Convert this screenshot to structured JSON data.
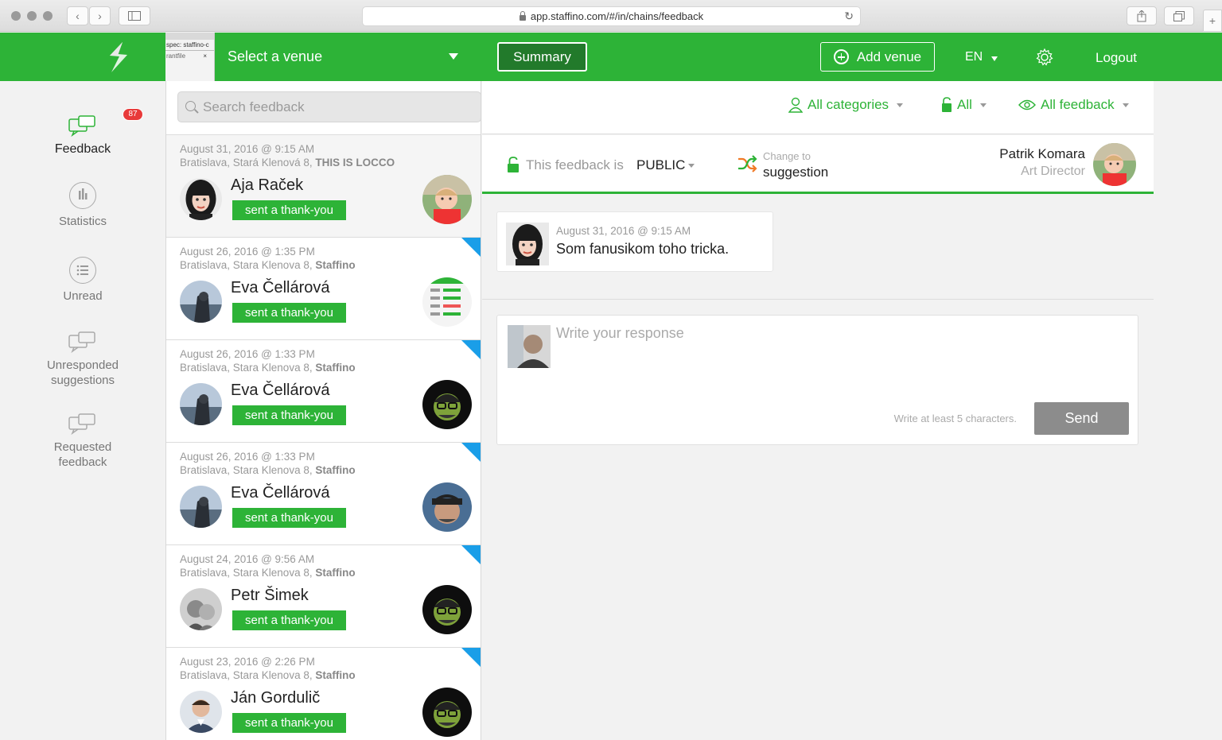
{
  "browser": {
    "url": "app.staffino.com/#/in/chains/feedback"
  },
  "header": {
    "venue_tab_line1": "spec: staffino-c",
    "venue_tab_line2": "rantfile",
    "venue_tab_close": "×",
    "venue_select": "Select a venue",
    "summary": "Summary",
    "add_venue": "Add venue",
    "language": "EN",
    "logout": "Logout",
    "brand_color": "#2db337"
  },
  "sidebar": {
    "badge": "87",
    "items": [
      {
        "label": "Feedback",
        "icon": "chat-bubbles-icon"
      },
      {
        "label": "Statistics",
        "icon": "bar-chart-icon"
      },
      {
        "label": "Unread",
        "icon": "list-icon"
      },
      {
        "label": "Unresponded suggestions",
        "icon": "chat-bubbles-icon"
      },
      {
        "label": "Requested feedback",
        "icon": "chat-bubbles-icon"
      }
    ]
  },
  "search": {
    "placeholder": "Search feedback"
  },
  "filters": {
    "categories": "All categories",
    "visibility": "All",
    "feedback": "All feedback"
  },
  "feedback_list": [
    {
      "date": "August 31, 2016 @ 9:15 AM",
      "location": "Bratislava, Stará Klenová 8, ",
      "venue": "THIS IS LOCCO",
      "name": "Aja Raček",
      "action": "sent a thank-you",
      "unread": false
    },
    {
      "date": "August 26, 2016 @ 1:35 PM",
      "location": "Bratislava, Stara Klenova 8, ",
      "venue": "Staffino",
      "name": "Eva Čellárová",
      "action": "sent a thank-you",
      "unread": true
    },
    {
      "date": "August 26, 2016 @ 1:33 PM",
      "location": "Bratislava, Stara Klenova 8, ",
      "venue": "Staffino",
      "name": "Eva Čellárová",
      "action": "sent a thank-you",
      "unread": true
    },
    {
      "date": "August 26, 2016 @ 1:33 PM",
      "location": "Bratislava, Stara Klenova 8, ",
      "venue": "Staffino",
      "name": "Eva Čellárová",
      "action": "sent a thank-you",
      "unread": true
    },
    {
      "date": "August 24, 2016 @ 9:56 AM",
      "location": "Bratislava, Stara Klenova 8, ",
      "venue": "Staffino",
      "name": "Petr Šimek",
      "action": "sent a thank-you",
      "unread": true
    },
    {
      "date": "August 23, 2016 @ 2:26 PM",
      "location": "Bratislava, Stara Klenova 8, ",
      "venue": "Staffino",
      "name": "Ján Gordulič",
      "action": "sent a thank-you",
      "unread": true
    }
  ],
  "detail": {
    "visibility_label": "This feedback is",
    "visibility_value": "PUBLIC",
    "change_to_label": "Change to",
    "change_to_value": "suggestion",
    "staff_name": "Patrik Komara",
    "staff_role": "Art Director",
    "message_date": "August 31, 2016 @ 9:15 AM",
    "message_text": "Som fanusikom toho tricka.",
    "response_placeholder": "Write your response",
    "response_hint": "Write at least 5 characters.",
    "send": "Send"
  }
}
